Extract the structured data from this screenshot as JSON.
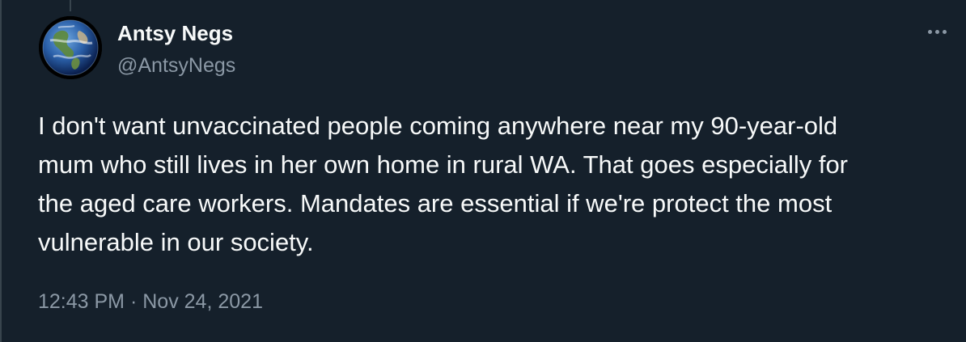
{
  "tweet": {
    "author": {
      "display_name": "Antsy Negs",
      "handle": "@AntsyNegs",
      "avatar_icon": "earth-globe"
    },
    "text_lines": [
      "I don't want unvaccinated people coming anywhere near my 90-year-old",
      "mum who still lives in her own home in rural WA. That goes especially for",
      "the aged care workers. Mandates are essential if we're protect the most",
      "vulnerable in our society."
    ],
    "time": "12:43 PM",
    "separator": "·",
    "date": "Nov 24, 2021",
    "more_icon": "more-options-icon"
  },
  "colors": {
    "background": "#15202b",
    "primary_text": "#f7f9f9",
    "secondary_text": "#8b98a5",
    "border": "#38444d"
  }
}
